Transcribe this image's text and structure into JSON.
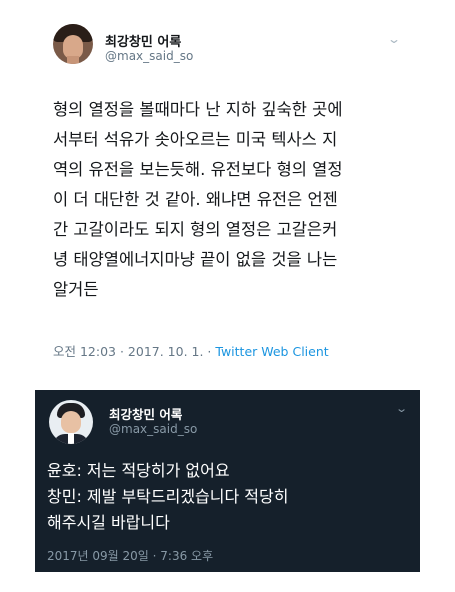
{
  "tweet1": {
    "display_name": "최강창민 어록",
    "handle": "@max_said_so",
    "body_lines": [
      "형의 열정을 볼때마다 난 지하 깊숙한 곳에",
      "서부터 석유가 솟아오르는 미국 텍사스 지",
      "역의 유전을 보는듯해. 유전보다 형의 열정",
      "이 더 대단한 것 같아. 왜냐면 유전은 언젠",
      "간 고갈이라도 되지 형의 열정은 고갈은커",
      "녕 태양열에너지마냥 끝이 없을 것을 나는",
      "알거든"
    ],
    "timestamp": "오전 12:03 · 2017. 10. 1. · ",
    "client": "Twitter Web Client",
    "chevron_icon": "chevron-down-icon",
    "colors": {
      "background": "#ffffff",
      "text": "#14171a",
      "muted": "#657786",
      "link": "#1b95e0"
    }
  },
  "tweet2": {
    "display_name": "최강창민 어록",
    "handle": "@max_said_so",
    "body_lines": [
      "윤호: 저는 적당히가 없어요",
      "창민: 제발 부탁드리겠습니다 적당히",
      "해주시길 바랍니다"
    ],
    "timestamp": "2017년 09월 20일 · 7:36 오후",
    "chevron_icon": "chevron-down-icon",
    "colors": {
      "background": "#15202b",
      "text": "#ffffff",
      "muted": "#8899a6"
    }
  }
}
